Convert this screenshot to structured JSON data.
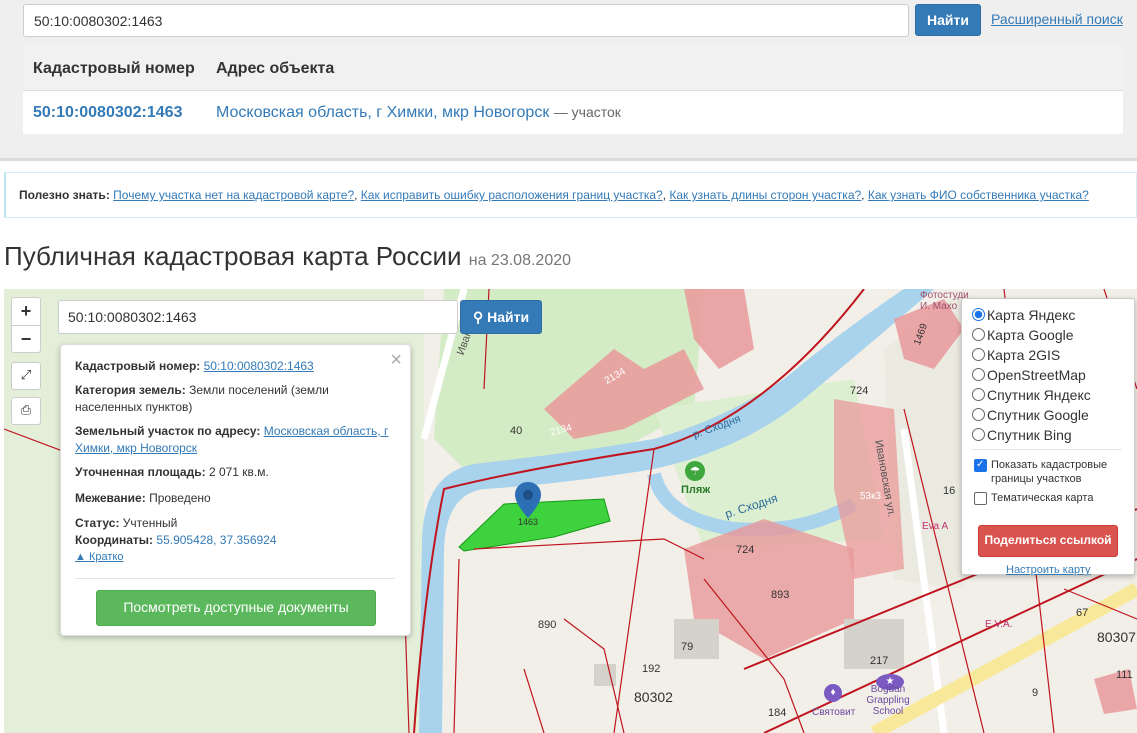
{
  "search": {
    "value": "50:10:0080302:1463",
    "button": "Найти",
    "advanced": "Расширенный поиск"
  },
  "results": {
    "headers": [
      "Кадастровый номер",
      "Адрес объекта"
    ],
    "rows": [
      {
        "number": "50:10:0080302:1463",
        "address": "Московская область, г Химки, мкр Новогорск",
        "type": "— участок"
      }
    ]
  },
  "useful": {
    "label": "Полезно знать:",
    "links": [
      "Почему участка нет на кадастровой карте?",
      "Как исправить ошибку расположения границ участка?",
      "Как узнать длины сторон участка?",
      "Как узнать ФИО собственника участка?"
    ]
  },
  "page": {
    "title": "Публичная кадастровая карта России",
    "date": "на 23.08.2020"
  },
  "map": {
    "zoom_in": "+",
    "zoom_out": "−",
    "search_value": "50:10:0080302:1463",
    "search_button": "Найти",
    "info": {
      "cad_label": "Кадастровый номер:",
      "cad_value": "50:10:0080302:1463",
      "cat_label": "Категория земель:",
      "cat_value": "Земли поселений (земли населенных пунктов)",
      "addr_label": "Земельный участок по адресу:",
      "addr_value": "Московская область, г Химки, мкр Новогорск",
      "area_label": "Уточненная площадь:",
      "area_value": "2 071 кв.м.",
      "survey_label": "Межевание:",
      "survey_value": "Проведено",
      "status_label": "Статус:",
      "status_value": "Учтенный",
      "coords_label": "Координаты:",
      "coords_value": "55.905428, 37.356924",
      "brief": "Кратко",
      "docs_button": "Посмотреть доступные документы",
      "close": "×"
    },
    "layers": {
      "options": [
        "Карта Яндекс",
        "Карта Google",
        "Карта 2GIS",
        "OpenStreetMap",
        "Спутник Яндекс",
        "Спутник Google",
        "Спутник Bing"
      ],
      "show_borders": "Показать кадастровые границы участков",
      "thematic": "Тематическая карта",
      "share": "Поделиться ссылкой",
      "tune": "Настроить карту"
    },
    "labels": {
      "street1": "Иванов",
      "street2": "Ивановская ул.",
      "river1": "р. Сходня",
      "river2": "р. Сходня",
      "beach": "Пляж",
      "n1463": "1463",
      "n890": "890",
      "n40": "40",
      "n2134a": "2134",
      "n2134b": "2134",
      "n724a": "724",
      "n724b": "724",
      "n893": "893",
      "n1469": "1469",
      "n79": "79",
      "n192": "192",
      "n80302": "80302",
      "n184": "184",
      "n217": "217",
      "n9": "9",
      "n80307": "80307",
      "n111": "111",
      "n16": "16",
      "n67": "67",
      "n53k3": "53к3",
      "eva1": "Eva A",
      "eva2": "E.V.A.",
      "bogdan": "Bogdan Grappling School",
      "svyat": "Святовит",
      "photo": "Фотостуди И. Махо"
    }
  }
}
